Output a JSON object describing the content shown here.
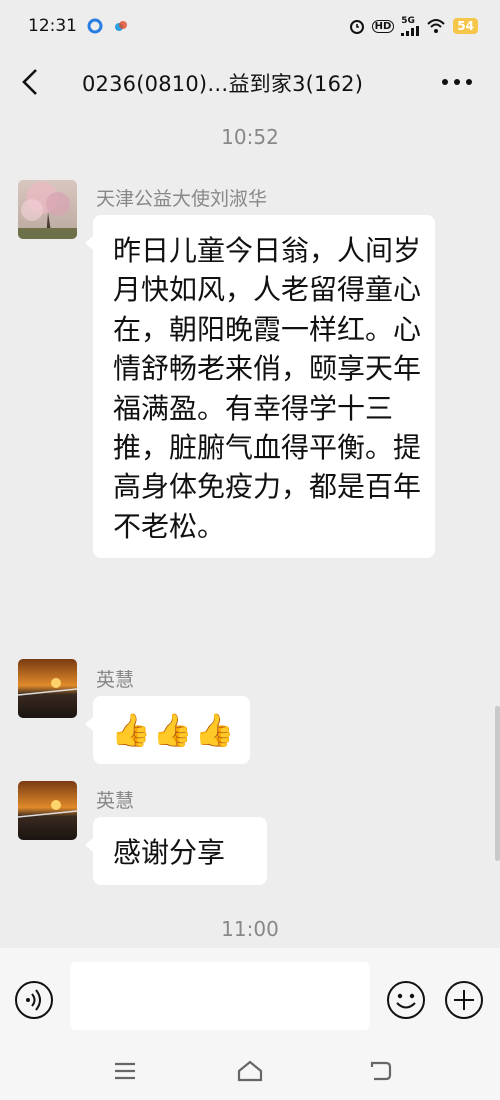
{
  "status_bar": {
    "time": "12:31",
    "network": "5G",
    "hd": "HD",
    "battery": "54"
  },
  "header": {
    "title": "0236(0810)…益到家3(162)"
  },
  "messages": {
    "timestamp_1": "10:52",
    "msg1": {
      "sender": "天津公益大使刘淑华",
      "text": "昨日儿童今日翁，人间岁月快如风，人老留得童心在，朝阳晚霞一样红。心情舒畅老来俏，颐享天年福满盈。有幸得学十三推，脏腑气血得平衡。提高身体免疫力，都是百年不老松。"
    },
    "msg2": {
      "sender": "英慧",
      "emoji": [
        "👍",
        "👍",
        "👍"
      ]
    },
    "msg3": {
      "sender": "英慧",
      "text": "感谢分享"
    },
    "timestamp_2": "11:00"
  },
  "input_bar": {
    "value": "",
    "placeholder": ""
  },
  "icons": {
    "back": "back-arrow-icon",
    "more": "more-dots-icon",
    "voice": "voice-icon",
    "emoji": "emoji-icon",
    "plus": "plus-icon"
  }
}
